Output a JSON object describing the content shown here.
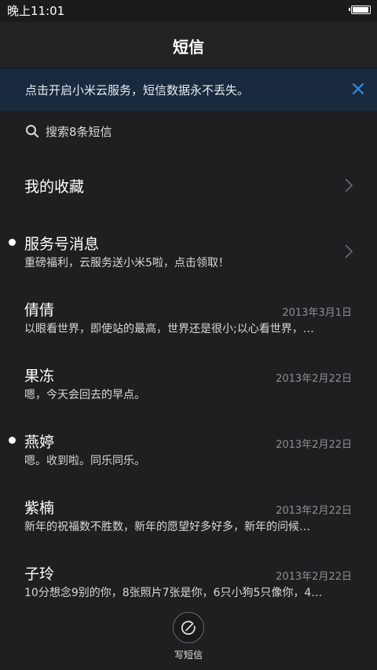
{
  "status_bar": {
    "time": "晚上11:01"
  },
  "header": {
    "title": "短信"
  },
  "banner": {
    "text": "点击开启小米云服务，短信数据永不丢失。"
  },
  "search": {
    "label": "搜索8条短信"
  },
  "favorites": {
    "label": "我的收藏"
  },
  "service": {
    "name": "服务号消息",
    "preview": "重磅福利，云服务送小米5啦，点击领取！",
    "unread": true
  },
  "threads": [
    {
      "name": "倩倩",
      "date": "2013年3月1日",
      "preview": "以眼看世界，即使站的最高，世界还是很小;以心看世界，…",
      "unread": false
    },
    {
      "name": "果冻",
      "date": "2013年2月22日",
      "preview": "嗯，今天会回去的早点。",
      "unread": false
    },
    {
      "name": "燕婷",
      "date": "2013年2月22日",
      "preview": "嗯。收到啦。同乐同乐。",
      "unread": true
    },
    {
      "name": "紫楠",
      "date": "2013年2月22日",
      "preview": "新年的祝福数不胜数，新年的愿望好多好多，新年的问候…",
      "unread": false
    },
    {
      "name": "子玲",
      "date": "2013年2月22日",
      "preview": "10分想念9别的你，8张照片7张是你，6只小狗5只像你，4…",
      "unread": false
    }
  ],
  "compose": {
    "label": "写短信"
  },
  "colors": {
    "background": "#1f1f21",
    "banner_background": "#1a2a3e",
    "accent": "#2f8ee6",
    "date_text": "#8e8e93"
  }
}
